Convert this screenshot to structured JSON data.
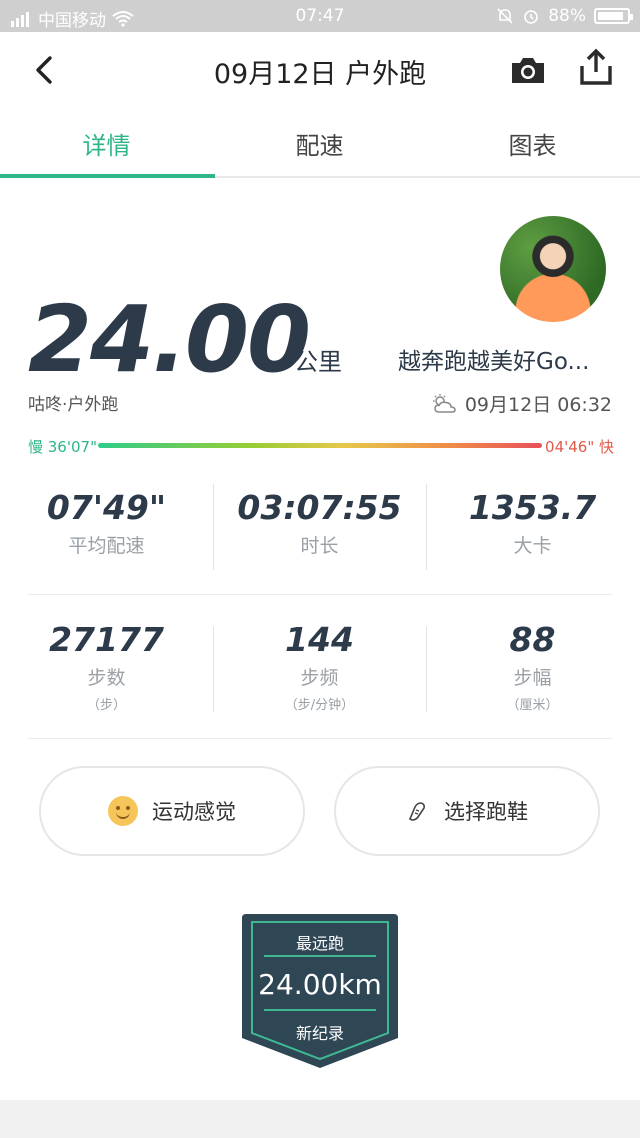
{
  "status_bar": {
    "carrier": "中国移动",
    "time": "07:47",
    "battery": "88%",
    "battery_level": 0.88
  },
  "header": {
    "title": "09月12日 户外跑",
    "back_icon": "chevron-left-icon",
    "camera_icon": "camera-icon",
    "share_icon": "share-icon"
  },
  "tabs": [
    {
      "label": "详情",
      "active": true
    },
    {
      "label": "配速",
      "active": false
    },
    {
      "label": "图表",
      "active": false
    }
  ],
  "summary": {
    "distance": "24.00",
    "unit": "公里",
    "username": "越奔跑越美好Go...",
    "source": "咕咚·户外跑",
    "datetime": "09月12日 06:32",
    "weather_icon": "partly-cloudy-icon"
  },
  "pace_range": {
    "slow_label": "慢 36'07\"",
    "fast_label": "04'46\" 快"
  },
  "stats_row1": [
    {
      "value": "07'49\"",
      "label": "平均配速"
    },
    {
      "value": "03:07:55",
      "label": "时长"
    },
    {
      "value": "1353.7",
      "label": "大卡"
    }
  ],
  "stats_row2": [
    {
      "value": "27177",
      "label": "步数",
      "sub": "（步）"
    },
    {
      "value": "144",
      "label": "步频",
      "sub": "（步/分钟）"
    },
    {
      "value": "88",
      "label": "步幅",
      "sub": "（厘米）"
    }
  ],
  "buttons": {
    "feeling": "运动感觉",
    "shoes": "选择跑鞋"
  },
  "badge": {
    "top": "最远跑",
    "value": "24.00km",
    "bottom": "新纪录"
  },
  "colors": {
    "accent": "#2eb58a",
    "badge_bg": "#2f4655",
    "badge_border": "#3fb893"
  }
}
